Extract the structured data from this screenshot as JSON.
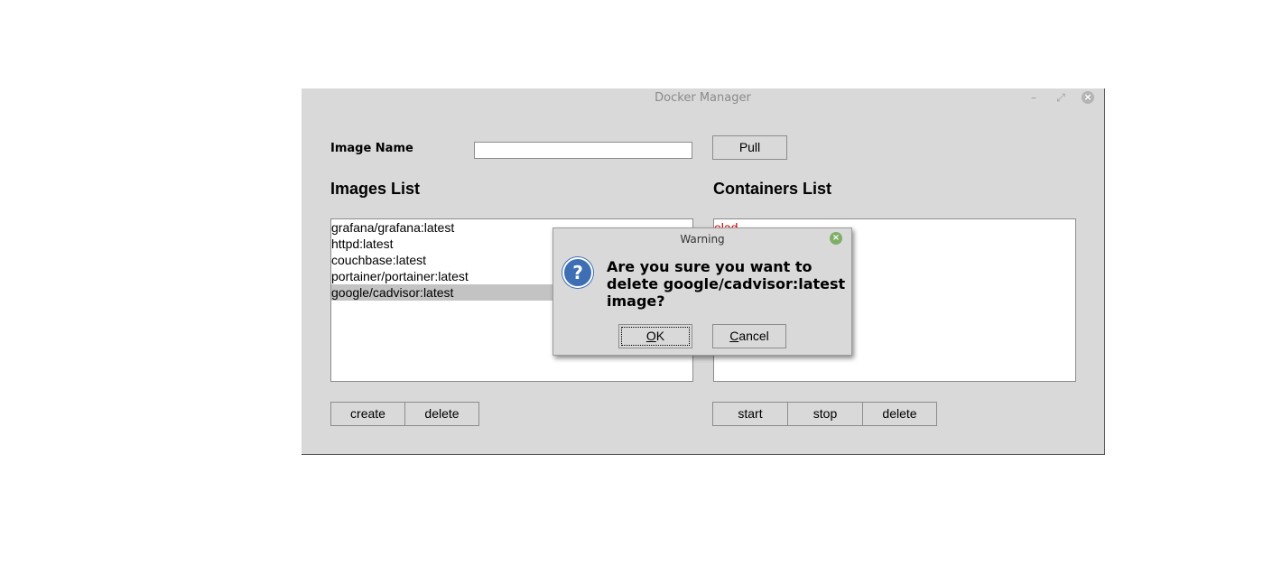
{
  "window": {
    "title": "Docker Manager",
    "minimize_glyph": "–",
    "maximize_glyph": "⤢",
    "close_glyph": "×"
  },
  "form": {
    "image_name_label": "Image Name",
    "image_name_value": "",
    "pull_label": "Pull"
  },
  "images": {
    "heading": "Images List",
    "items": [
      "grafana/grafana:latest",
      "httpd:latest",
      "couchbase:latest",
      "portainer/portainer:latest",
      "google/cadvisor:latest"
    ],
    "selected_index": 4,
    "create_label": "create",
    "delete_label": "delete"
  },
  "containers": {
    "heading": "Containers List",
    "items": [
      "elad"
    ],
    "start_label": "start",
    "stop_label": "stop",
    "delete_label": "delete"
  },
  "dialog": {
    "title": "Warning",
    "icon": "question-icon",
    "icon_glyph": "?",
    "close_glyph": "×",
    "message": "Are you sure you want to delete google/cadvisor:latest image?",
    "ok_mnemonic": "O",
    "ok_rest": "K",
    "cancel_mnemonic": "C",
    "cancel_rest": "ancel"
  },
  "colors": {
    "window_bg": "#d9d9d9",
    "selection": "#c3c3c3",
    "container_text": "#d00000",
    "question_icon": "#3e6fb4",
    "dialog_close": "#7fae68"
  }
}
